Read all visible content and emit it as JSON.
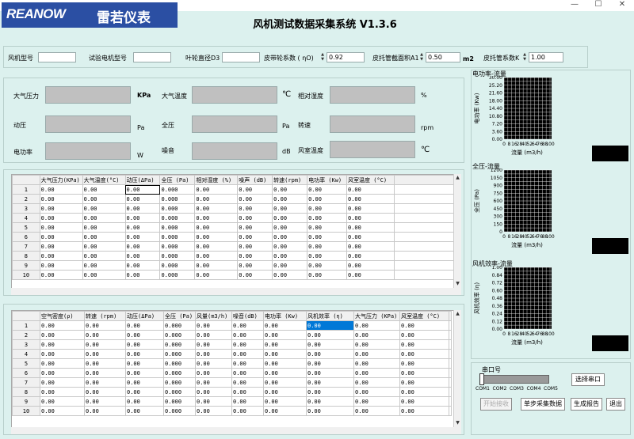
{
  "window": {
    "minimize": "—",
    "maximize": "☐",
    "close": "✕"
  },
  "logo": {
    "brand": "REANOW",
    "brand_cn": "雷若仪表"
  },
  "app_title": "风机测试数据采集系统 V1.3.6",
  "params": {
    "fan_model_label": "风机型号",
    "fan_model_value": "",
    "test_motor_label": "试验电机型号",
    "test_motor_value": "",
    "impeller_label": "叶轮直径D3",
    "impeller_value": "",
    "belt_label": "皮带轮系数 ( ηO)",
    "belt_value": "0.92",
    "pitot_area_label": "皮托管截面积A1",
    "pitot_area_value": "0.50",
    "pitot_area_unit": "m2",
    "pitot_coef_label": "皮托管系数K",
    "pitot_coef_value": "1.00"
  },
  "readings": {
    "atm_pressure": {
      "label": "大气压力",
      "unit": "KPa"
    },
    "atm_temp": {
      "label": "大气温度",
      "unit": "℃"
    },
    "humidity": {
      "label": "相对湿度",
      "unit": "%"
    },
    "dyn_pressure": {
      "label": "动压",
      "unit": "Pa"
    },
    "total_pressure": {
      "label": "全压",
      "unit": "Pa"
    },
    "speed": {
      "label": "转速",
      "unit": "rpm"
    },
    "power": {
      "label": "电功率",
      "unit": "W"
    },
    "noise": {
      "label": "噪音",
      "unit": "dB"
    },
    "chamber_temp": {
      "label": "风室温度",
      "unit": "℃"
    }
  },
  "table1": {
    "headers": [
      "大气压力(KPa)",
      "大气温度(°C)",
      "动压(ΔPa)",
      "全压 (Pa)",
      "相对湿度 (%)",
      "噪声 (dB)",
      "转速(rpm)",
      "电功率 (Kw)",
      "风室温度 (°C)"
    ],
    "row_labels": [
      "1",
      "2",
      "3",
      "4",
      "5",
      "6",
      "7",
      "8",
      "9",
      "10"
    ],
    "rows": [
      [
        "0.00",
        "0.00",
        "0.00",
        "0.000",
        "0.00",
        "0.00",
        "0.00",
        "0.00",
        "0.00"
      ],
      [
        "0.00",
        "0.00",
        "0.00",
        "0.000",
        "0.00",
        "0.00",
        "0.00",
        "0.00",
        "0.00"
      ],
      [
        "0.00",
        "0.00",
        "0.00",
        "0.000",
        "0.00",
        "0.00",
        "0.00",
        "0.00",
        "0.00"
      ],
      [
        "0.00",
        "0.00",
        "0.00",
        "0.000",
        "0.00",
        "0.00",
        "0.00",
        "0.00",
        "0.00"
      ],
      [
        "0.00",
        "0.00",
        "0.00",
        "0.000",
        "0.00",
        "0.00",
        "0.00",
        "0.00",
        "0.00"
      ],
      [
        "0.00",
        "0.00",
        "0.00",
        "0.000",
        "0.00",
        "0.00",
        "0.00",
        "0.00",
        "0.00"
      ],
      [
        "0.00",
        "0.00",
        "0.00",
        "0.000",
        "0.00",
        "0.00",
        "0.00",
        "0.00",
        "0.00"
      ],
      [
        "0.00",
        "0.00",
        "0.00",
        "0.000",
        "0.00",
        "0.00",
        "0.00",
        "0.00",
        "0.00"
      ],
      [
        "0.00",
        "0.00",
        "0.00",
        "0.000",
        "0.00",
        "0.00",
        "0.00",
        "0.00",
        "0.00"
      ],
      [
        "0.00",
        "0.00",
        "0.00",
        "0.000",
        "0.00",
        "0.00",
        "0.00",
        "0.00",
        "0.00"
      ]
    ]
  },
  "table2": {
    "headers": [
      "空气密度(ρ)",
      "转速 (rpm)",
      "动压(ΔPa)",
      "全压 (Pa)",
      "风量(m3/h)",
      "噪音(dB)",
      "电功率 (Kw)",
      "风机效率 (η)",
      "大气压力 (KPa)",
      "风室温度 (°C)"
    ],
    "row_labels": [
      "1",
      "2",
      "3",
      "4",
      "5",
      "6",
      "7",
      "8",
      "9",
      "10"
    ],
    "rows": [
      [
        "0.00",
        "0.00",
        "0.00",
        "0.000",
        "0.00",
        "0.00",
        "0.00",
        "0.00",
        "0.00",
        "0.00"
      ],
      [
        "0.00",
        "0.00",
        "0.00",
        "0.000",
        "0.00",
        "0.00",
        "0.00",
        "0.00",
        "0.00",
        "0.00"
      ],
      [
        "0.00",
        "0.00",
        "0.00",
        "0.000",
        "0.00",
        "0.00",
        "0.00",
        "0.00",
        "0.00",
        "0.00"
      ],
      [
        "0.00",
        "0.00",
        "0.00",
        "0.000",
        "0.00",
        "0.00",
        "0.00",
        "0.00",
        "0.00",
        "0.00"
      ],
      [
        "0.00",
        "0.00",
        "0.00",
        "0.000",
        "0.00",
        "0.00",
        "0.00",
        "0.00",
        "0.00",
        "0.00"
      ],
      [
        "0.00",
        "0.00",
        "0.00",
        "0.000",
        "0.00",
        "0.00",
        "0.00",
        "0.00",
        "0.00",
        "0.00"
      ],
      [
        "0.00",
        "0.00",
        "0.00",
        "0.000",
        "0.00",
        "0.00",
        "0.00",
        "0.00",
        "0.00",
        "0.00"
      ],
      [
        "0.00",
        "0.00",
        "0.00",
        "0.000",
        "0.00",
        "0.00",
        "0.00",
        "0.00",
        "0.00",
        "0.00"
      ],
      [
        "0.00",
        "0.00",
        "0.00",
        "0.000",
        "0.00",
        "0.00",
        "0.00",
        "0.00",
        "0.00",
        "0.00"
      ],
      [
        "0.00",
        "0.00",
        "0.00",
        "0.000",
        "0.00",
        "0.00",
        "0.00",
        "0.00",
        "0.00",
        "0.00"
      ]
    ]
  },
  "chart_data": [
    {
      "type": "line",
      "title": "电功率-流量",
      "xlabel": "流量 (m3/h)",
      "ylabel": "电功率 (Kw)",
      "xticks": [
        "0",
        "8",
        "16",
        "28",
        "40",
        "52",
        "64",
        "76",
        "88",
        "100"
      ],
      "yticks": [
        "30.00",
        "25.20",
        "21.60",
        "18.00",
        "14.40",
        "10.80",
        "7.20",
        "3.60",
        "0.00"
      ],
      "xlim": [
        0,
        100
      ],
      "ylim": [
        0,
        30
      ],
      "grid": true,
      "series": []
    },
    {
      "type": "line",
      "title": "全压-流量",
      "xlabel": "流量 (m3/h)",
      "ylabel": "全压 (Pa)",
      "xticks": [
        "0",
        "8",
        "16",
        "28",
        "40",
        "52",
        "64",
        "76",
        "88",
        "100"
      ],
      "yticks": [
        "1200",
        "1050",
        "900",
        "750",
        "600",
        "450",
        "300",
        "150",
        "0"
      ],
      "xlim": [
        0,
        100
      ],
      "ylim": [
        0,
        1200
      ],
      "grid": true,
      "series": []
    },
    {
      "type": "line",
      "title": "风机效率-流量",
      "xlabel": "流量 (m3/h)",
      "ylabel": "风机效率 (η)",
      "xticks": [
        "0",
        "8",
        "16",
        "28",
        "40",
        "52",
        "64",
        "76",
        "88",
        "100"
      ],
      "yticks": [
        "1.00",
        "0.84",
        "0.72",
        "0.60",
        "0.48",
        "0.36",
        "0.24",
        "0.12",
        "0.00"
      ],
      "xlim": [
        0,
        100
      ],
      "ylim": [
        0,
        1
      ],
      "grid": true,
      "series": []
    }
  ],
  "serial": {
    "label": "串口号",
    "ticks": [
      "COM1",
      "COM2",
      "COM3",
      "COM4",
      "COM5"
    ],
    "level": 0,
    "select_button": "选择串口"
  },
  "buttons": {
    "start": "开始接收",
    "single": "单步采集数据",
    "report": "生成报告",
    "exit": "退出"
  }
}
